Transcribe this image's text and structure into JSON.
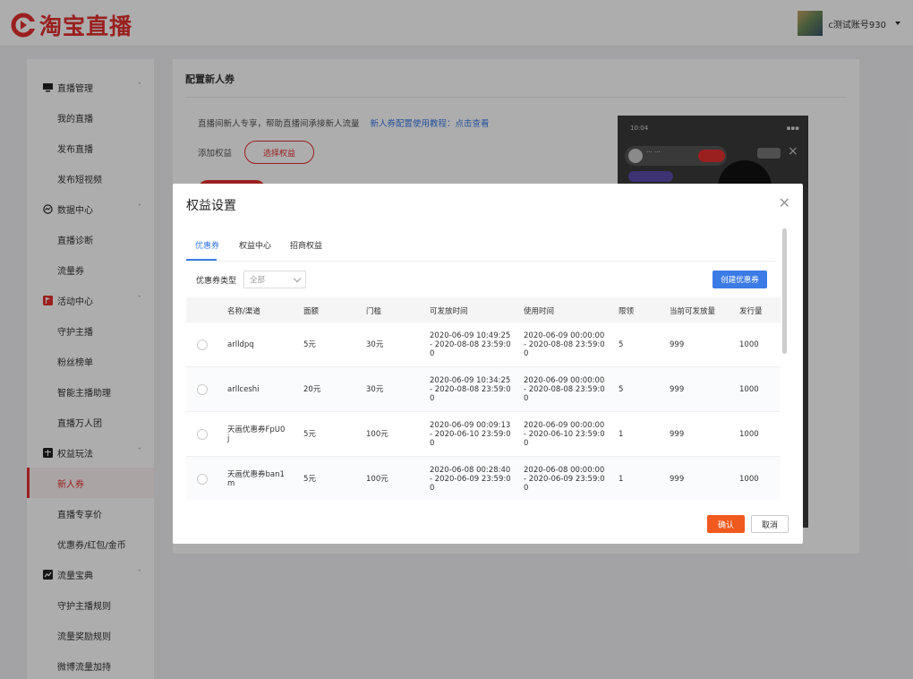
{
  "header": {
    "logo_text": "淘宝直播",
    "username": "c测试账号930"
  },
  "sidebar": {
    "groups": [
      {
        "label": "直播管理",
        "items": [
          "我的直播",
          "发布直播",
          "发布短视频"
        ]
      },
      {
        "label": "数据中心",
        "items": [
          "直播诊断",
          "流量券"
        ]
      },
      {
        "label": "活动中心",
        "items": [
          "守护主播",
          "粉丝榜单",
          "智能主播助理",
          "直播万人团"
        ]
      },
      {
        "label": "权益玩法",
        "items": [
          "新人券",
          "直播专享价",
          "优惠券/红包/金币"
        ]
      },
      {
        "label": "流量宝典",
        "items": [
          "守护主播规则",
          "流量奖励规则",
          "微博流量加持"
        ]
      }
    ],
    "active_item": "新人券"
  },
  "main": {
    "title": "配置新人券",
    "intro": "直播间新人专享，帮助直播间承接新人流量",
    "intro_link": "新人券配置使用教程：点击查看",
    "add_label": "添加权益",
    "select_button": "选择权益"
  },
  "modal": {
    "title": "权益设置",
    "tabs": [
      "优惠券",
      "权益中心",
      "招商权益"
    ],
    "active_tab": "优惠券",
    "filter_label": "优惠券类型",
    "filter_value": "全部",
    "create_button": "创建优惠券",
    "columns": [
      "名称/渠道",
      "面额",
      "门槛",
      "可发放时间",
      "使用时间",
      "限领",
      "当前可发放量",
      "发行量"
    ],
    "rows": [
      {
        "name": "arlldpq",
        "amount": "5元",
        "threshold": "30元",
        "issue_time": "2020-06-09 10:49:25 - 2020-08-08 23:59:00",
        "use_time": "2020-06-09 00:00:00 - 2020-08-08 23:59:00",
        "limit": "5",
        "available": "999",
        "issued": "1000"
      },
      {
        "name": "arllceshi",
        "amount": "20元",
        "threshold": "30元",
        "issue_time": "2020-06-09 10:34:25 - 2020-08-08 23:59:00",
        "use_time": "2020-06-09 00:00:00 - 2020-08-08 23:59:00",
        "limit": "5",
        "available": "999",
        "issued": "1000"
      },
      {
        "name": "天画优惠券FpU0j",
        "amount": "5元",
        "threshold": "100元",
        "issue_time": "2020-06-09 00:09:13 - 2020-06-10 23:59:00",
        "use_time": "2020-06-09 00:00:00 - 2020-06-10 23:59:00",
        "limit": "1",
        "available": "999",
        "issued": "1000"
      },
      {
        "name": "天画优惠券ban1m",
        "amount": "5元",
        "threshold": "100元",
        "issue_time": "2020-06-08 00:28:40 - 2020-06-09 23:59:00",
        "use_time": "2020-06-08 00:00:00 - 2020-06-09 23:59:00",
        "limit": "1",
        "available": "999",
        "issued": "1000"
      }
    ],
    "confirm_button": "确认",
    "cancel_button": "取消"
  },
  "colors": {
    "brand": "#e3302f",
    "link": "#3b7be6",
    "confirm": "#f05a1e"
  }
}
